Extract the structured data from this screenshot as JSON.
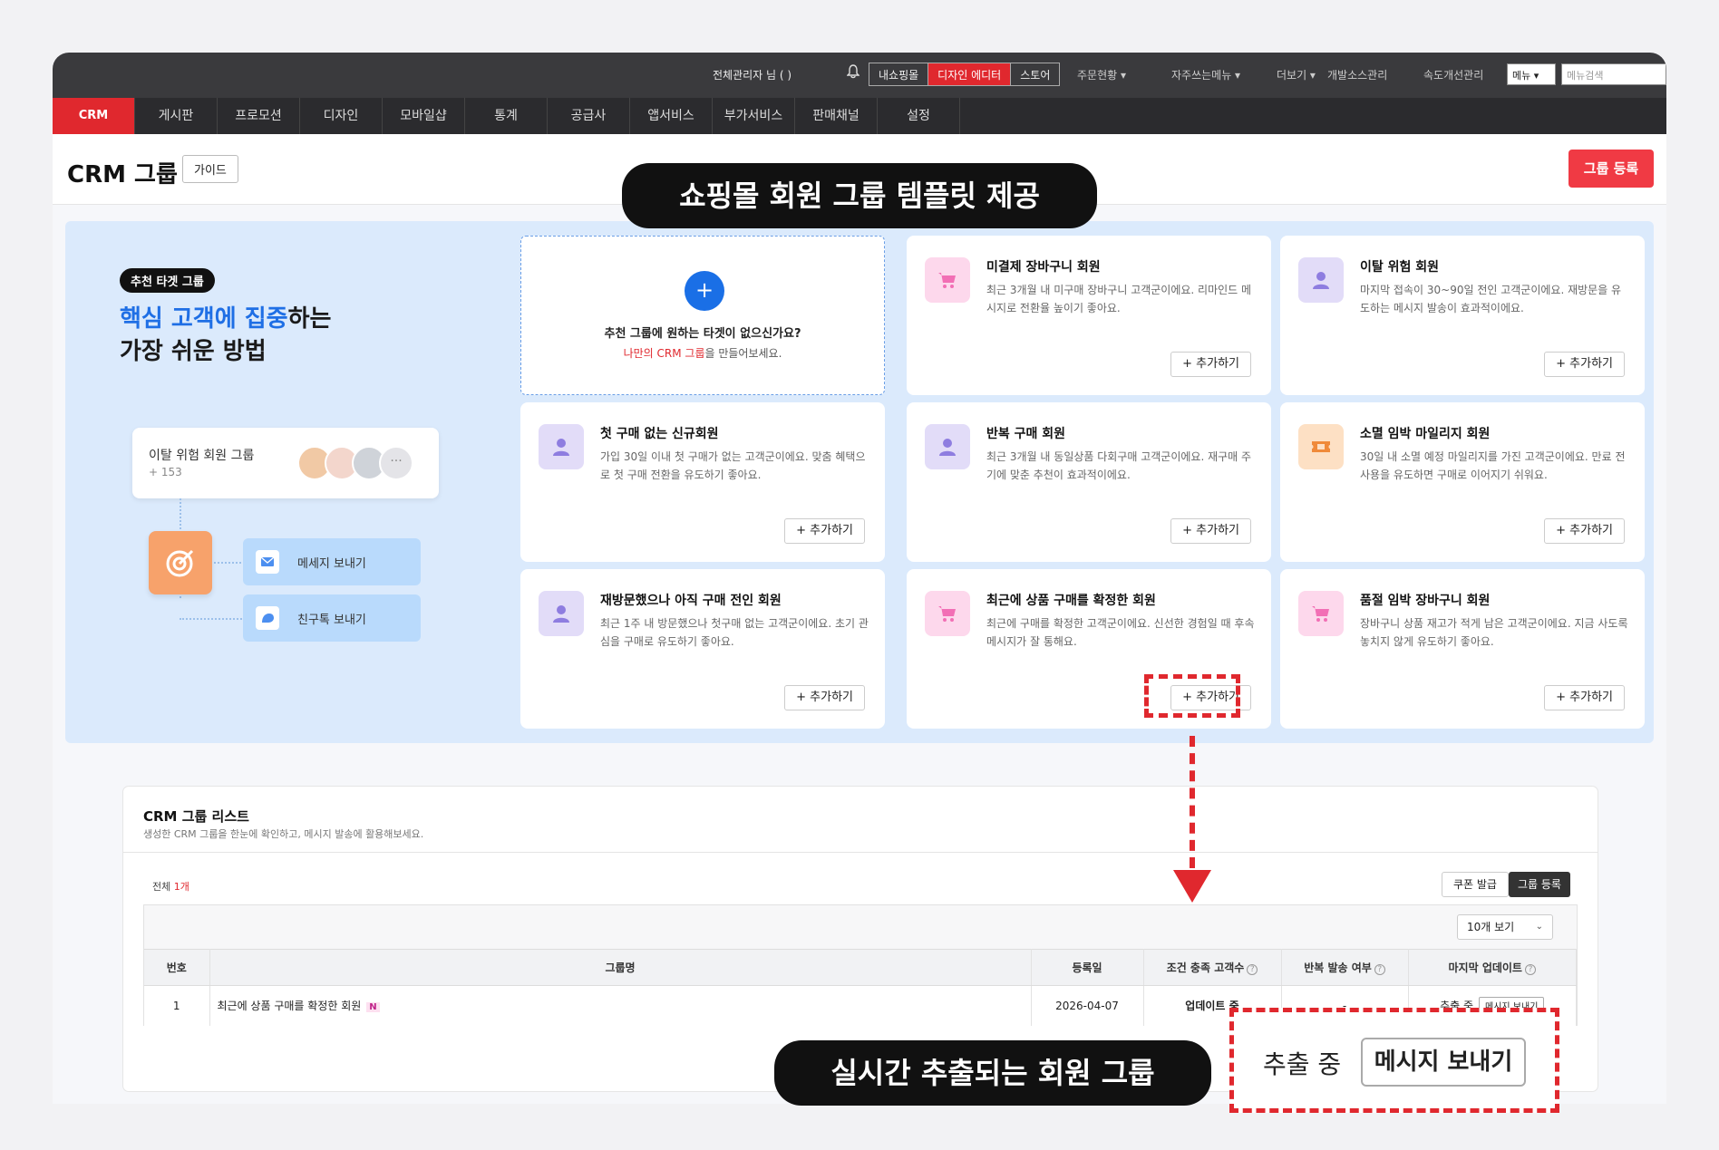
{
  "topbar": {
    "admin": "전체관리자 님 (          )",
    "box_items": [
      "내쇼핑몰",
      "디자인 에디터",
      "스토어"
    ],
    "menus": [
      "주문현황 ▾",
      "자주쓰는메뉴 ▾",
      "더보기 ▾",
      "개발소스관리",
      "속도개선관리"
    ],
    "select_value": "메뉴",
    "search_placeholder": "메뉴검색"
  },
  "nav": [
    "CRM",
    "게시판",
    "프로모션",
    "디자인",
    "모바일샵",
    "통계",
    "공급사",
    "앱서비스",
    "부가서비스",
    "판매채널",
    "설정"
  ],
  "header": {
    "title": "CRM 그룹",
    "guide": "가이드",
    "register": "그룹 등록"
  },
  "hero": {
    "badge": "추천 타겟 그룹",
    "title_blue1": "핵심 고객",
    "title_mid": "에 ",
    "title_blue2": "집중",
    "title_rest": "하는",
    "title_line2": "가장 쉬운 방법",
    "risk_title": "이탈 위험 회원 그룹",
    "risk_count": "+ 153",
    "more": "···",
    "send_message": "메세지 보내기",
    "send_friend": "친구톡 보내기"
  },
  "empty_card": {
    "question": "추천 그룹에 원하는 타겟이 없으신가요?",
    "link": "나만의 CRM 그룹",
    "suffix": "을 만들어보세요."
  },
  "cards": [
    {
      "title": "미결제 장바구니 회원",
      "desc": "최근 3개월 내 미구매 장바구니 고객군이에요. 리마인드 메시지로 전환율 높이기 좋아요.",
      "icon": "cart-icon",
      "add": "+ 추가하기"
    },
    {
      "title": "이탈 위험 회원",
      "desc": "마지막 접속이 30~90일 전인 고객군이에요. 재방문을 유도하는 메시지 발송이 효과적이에요.",
      "icon": "user-icon",
      "add": "+ 추가하기"
    },
    {
      "title": "첫 구매 없는 신규회원",
      "desc": "가입 30일 이내 첫 구매가 없는 고객군이에요. 맞춤 혜택으로 첫 구매 전환을 유도하기 좋아요.",
      "icon": "user-icon",
      "add": "+ 추가하기"
    },
    {
      "title": "반복 구매 회원",
      "desc": "최근 3개월 내 동일상품 다회구매 고객군이에요. 재구매 주기에 맞춘 추천이 효과적이에요.",
      "icon": "user-icon",
      "add": "+ 추가하기"
    },
    {
      "title": "소멸 임박 마일리지 회원",
      "desc": "30일 내 소멸 예정 마일리지를 가진 고객군이에요. 만료 전 사용을 유도하면 구매로 이어지기 쉬워요.",
      "icon": "ticket-icon",
      "add": "+ 추가하기"
    },
    {
      "title": "재방문했으나 아직 구매 전인 회원",
      "desc": "최근 1주 내 방문했으나 첫구매 없는 고객군이에요. 초기 관심을 구매로 유도하기 좋아요.",
      "icon": "user-icon",
      "add": "+ 추가하기"
    },
    {
      "title": "최근에 상품 구매를 확정한 회원",
      "desc": "최근에 구매를 확정한 고객군이에요. 신선한 경험일 때 후속 메시지가 잘 통해요.",
      "icon": "cart-icon",
      "add": "+ 추가하기"
    },
    {
      "title": "품절 임박 장바구니 회원",
      "desc": "장바구니 상품 재고가 적게 남은 고객군이에요. 지금 사도록 놓치지 않게 유도하기 좋아요.",
      "icon": "cart-icon",
      "add": "+ 추가하기"
    }
  ],
  "list": {
    "title": "CRM 그룹 리스트",
    "subtitle": "생성한 CRM 그룹을 한눈에 확인하고, 메시지 발송에 활용해보세요.",
    "total_label": "전체 ",
    "total_count": "1개",
    "coupon": "쿠폰 발급",
    "group_register": "그룹 등록",
    "view_select": "10개 보기",
    "headers": [
      "번호",
      "그룹명",
      "등록일",
      "조건 충족 고객수",
      "반복 발송 여부",
      "마지막 업데이트"
    ],
    "row": {
      "no": "1",
      "name": "최근에 상품 구매를 확정한 회원",
      "badge": "N",
      "date": "2026-04-07",
      "count": "업데이트 중",
      "repeat": "-",
      "status": "추출 중",
      "action": "메시지 보내기"
    }
  },
  "overlay": {
    "top_pill": "쇼핑몰 회원 그룹 템플릿 제공",
    "bottom_pill": "실시간 추출되는 회원 그룹",
    "zoom_status": "추출 중",
    "zoom_button": "메시지 보내기"
  }
}
